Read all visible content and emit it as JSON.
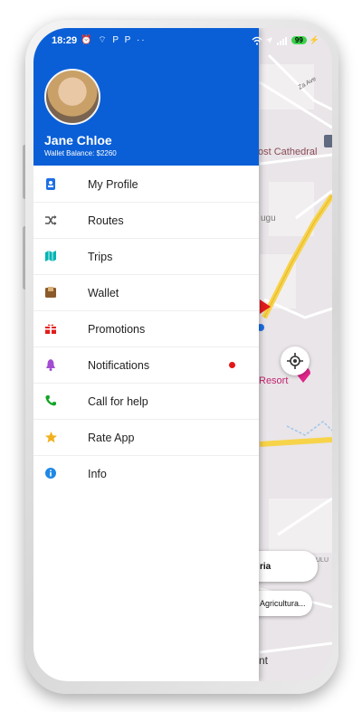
{
  "status_bar": {
    "time": "18:29",
    "left_icons": "⏰ ⌔ P P ··",
    "battery": "99"
  },
  "drawer": {
    "user_name": "Jane Chloe",
    "wallet_balance": "Wallet Balance: $2260",
    "header_color": "#0a5fd7",
    "items": [
      {
        "label": "My Profile",
        "icon": "profile-icon",
        "color": "#1e6fe6"
      },
      {
        "label": "Routes",
        "icon": "shuffle-icon",
        "color": "#555555"
      },
      {
        "label": "Trips",
        "icon": "map-icon",
        "color": "#00b4b4"
      },
      {
        "label": "Wallet",
        "icon": "wallet-icon",
        "color": "#8b5a2b"
      },
      {
        "label": "Promotions",
        "icon": "gift-icon",
        "color": "#e31c1c"
      },
      {
        "label": "Notifications",
        "icon": "bell-icon",
        "color": "#a34bd1",
        "has_dot": true
      },
      {
        "label": "Call for help",
        "icon": "phone-icon",
        "color": "#12a526"
      },
      {
        "label": "Rate App",
        "icon": "star-icon",
        "color": "#f2b01e"
      },
      {
        "label": "Info",
        "icon": "info-icon",
        "color": "#1e88e5"
      }
    ]
  },
  "map": {
    "labels": {
      "cathedral": "ost Cathedral",
      "road": "Za Ave",
      "area": "ugu",
      "resort": "Resort",
      "lulu": "ULU"
    },
    "chips": [
      "ria",
      "Agricultura..."
    ],
    "bottom_text": "nt"
  }
}
